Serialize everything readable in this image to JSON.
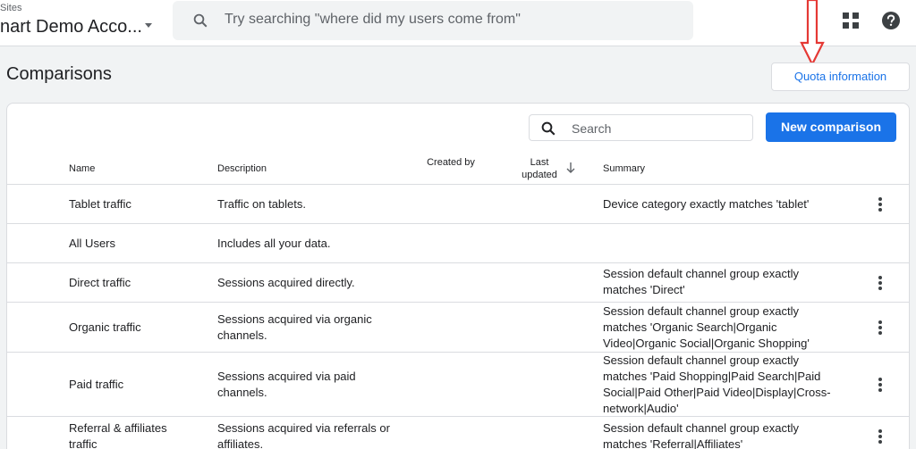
{
  "header": {
    "breadcrumb": "Sites",
    "account_name": "nart Demo Acco...",
    "search_placeholder": "Try searching \"where did my users come from\""
  },
  "page": {
    "title": "Comparisons",
    "quota_button": "Quota information"
  },
  "toolbar": {
    "search_placeholder": "Search",
    "new_button": "New comparison"
  },
  "table": {
    "columns": {
      "name": "Name",
      "description": "Description",
      "created_by": "Created by",
      "last_updated": "Last updated",
      "summary": "Summary"
    },
    "rows": [
      {
        "name": "Tablet traffic",
        "description": "Traffic on tablets.",
        "created_by": "",
        "last_updated": "",
        "summary": "Device category exactly matches 'tablet'"
      },
      {
        "name": "All Users",
        "description": "Includes all your data.",
        "created_by": "",
        "last_updated": "",
        "summary": ""
      },
      {
        "name": "Direct traffic",
        "description": "Sessions acquired directly.",
        "created_by": "",
        "last_updated": "",
        "summary": "Session default channel group exactly matches 'Direct'"
      },
      {
        "name": "Organic traffic",
        "description": "Sessions acquired via organic channels.",
        "created_by": "",
        "last_updated": "",
        "summary": "Session default channel group exactly matches 'Organic Search|Organic Video|Organic Social|Organic Shopping'"
      },
      {
        "name": "Paid traffic",
        "description": "Sessions acquired via paid channels.",
        "created_by": "",
        "last_updated": "",
        "summary": "Session default channel group exactly matches 'Paid Shopping|Paid Search|Paid Social|Paid Other|Paid Video|Display|Cross-network|Audio'"
      },
      {
        "name": "Referral & affiliates traffic",
        "description": "Sessions acquired via referrals or affiliates.",
        "created_by": "",
        "last_updated": "",
        "summary": "Session default channel group exactly matches 'Referral|Affiliates'"
      }
    ]
  },
  "colors": {
    "accent": "#1a73e8",
    "annotation_arrow": "#e53935",
    "background": "#f1f3f4"
  },
  "icons": {
    "search": "search-icon",
    "apps": "apps-grid-icon",
    "help": "help-icon",
    "sort": "arrow-down-icon",
    "more": "more-vert-icon"
  }
}
